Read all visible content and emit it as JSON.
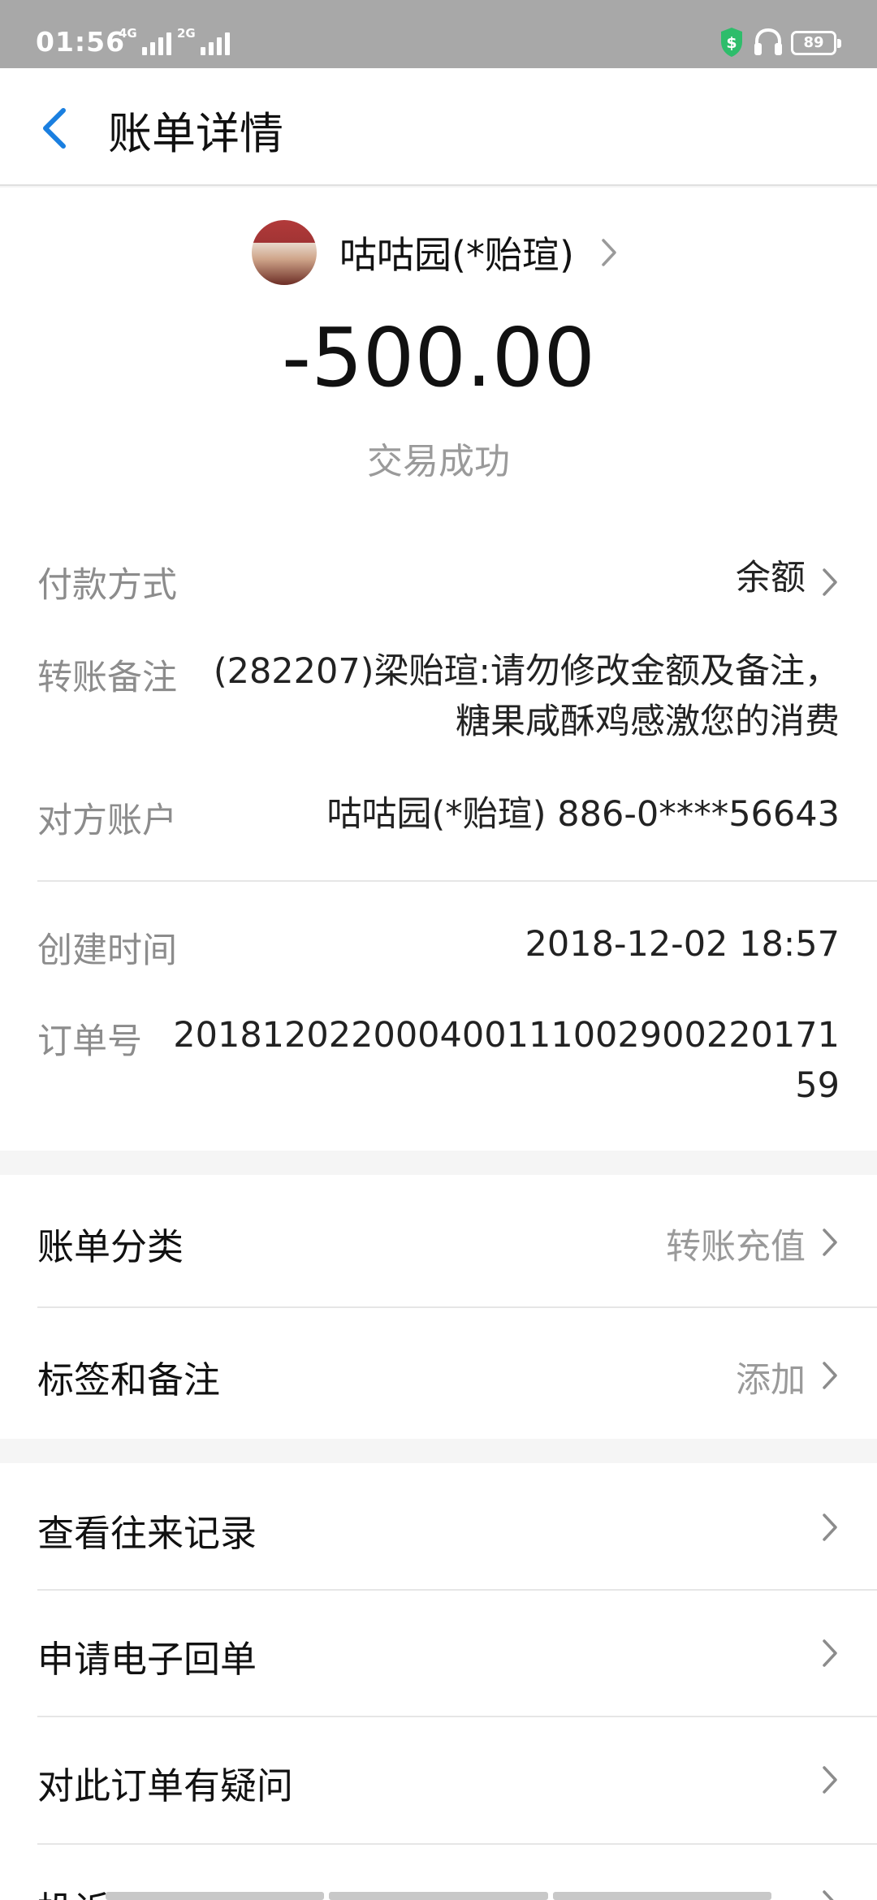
{
  "status_bar": {
    "time": "01:56",
    "net1": "4G",
    "net2": "2G",
    "battery": "89"
  },
  "nav": {
    "title": "账单详情"
  },
  "merchant": {
    "name": "咕咕园(*贻瑄)"
  },
  "amount": "-500.00",
  "status": "交易成功",
  "details": {
    "payment_method": {
      "label": "付款方式",
      "value": "余额"
    },
    "remark": {
      "label": "转账备注",
      "line1": "(282207)梁贻瑄:请勿修改金额及备注，",
      "line2": "糖果咸酥鸡感激您的消费"
    },
    "account": {
      "label": "对方账户",
      "value": "咕咕园(*贻瑄) 886-0****56643"
    },
    "created": {
      "label": "创建时间",
      "value": "2018-12-02 18:57"
    },
    "order": {
      "label": "订单号",
      "line1": "201812022000400111002900220171",
      "line2": "59"
    }
  },
  "category": {
    "label": "账单分类",
    "value": "转账充值"
  },
  "tags": {
    "label": "标签和备注",
    "value": "添加"
  },
  "actions": [
    {
      "label": "查看往来记录"
    },
    {
      "label": "申请电子回单"
    },
    {
      "label": "对此订单有疑问"
    },
    {
      "label": "投诉"
    }
  ]
}
